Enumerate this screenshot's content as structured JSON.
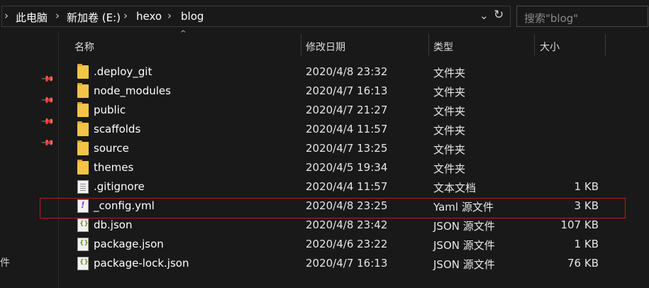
{
  "address_bar": {
    "crumbs": [
      "此电脑",
      "新加卷 (E:)",
      "hexo",
      "blog"
    ],
    "separator": "›",
    "chevron": "⌄",
    "refresh": "↻"
  },
  "search": {
    "placeholder": "搜索\"blog\""
  },
  "nav": {
    "pins": 4,
    "partial_label": "件"
  },
  "columns": {
    "name": "名称",
    "date": "修改日期",
    "type": "类型",
    "size": "大小"
  },
  "files": [
    {
      "name": ".deploy_git",
      "date": "2020/4/8 23:32",
      "type": "文件夹",
      "size": "",
      "icon": "folder-icon"
    },
    {
      "name": "node_modules",
      "date": "2020/4/7 16:13",
      "type": "文件夹",
      "size": "",
      "icon": "folder-icon"
    },
    {
      "name": "public",
      "date": "2020/4/7 21:27",
      "type": "文件夹",
      "size": "",
      "icon": "folder-icon"
    },
    {
      "name": "scaffolds",
      "date": "2020/4/4 11:57",
      "type": "文件夹",
      "size": "",
      "icon": "folder-icon"
    },
    {
      "name": "source",
      "date": "2020/4/7 13:25",
      "type": "文件夹",
      "size": "",
      "icon": "folder-icon"
    },
    {
      "name": "themes",
      "date": "2020/4/5 19:34",
      "type": "文件夹",
      "size": "",
      "icon": "folder-icon"
    },
    {
      "name": ".gitignore",
      "date": "2020/4/4 11:57",
      "type": "文本文档",
      "size": "1 KB",
      "icon": "text-file-icon"
    },
    {
      "name": "_config.yml",
      "date": "2020/4/8 23:25",
      "type": "Yaml 源文件",
      "size": "3 KB",
      "icon": "yaml-file-icon"
    },
    {
      "name": "db.json",
      "date": "2020/4/8 23:42",
      "type": "JSON 源文件",
      "size": "107 KB",
      "icon": "json-file-icon"
    },
    {
      "name": "package.json",
      "date": "2020/4/6 23:22",
      "type": "JSON 源文件",
      "size": "1 KB",
      "icon": "json-file-icon"
    },
    {
      "name": "package-lock.json",
      "date": "2020/4/7 16:13",
      "type": "JSON 源文件",
      "size": "76 KB",
      "icon": "json-file-icon"
    }
  ],
  "highlight_color": "#c4161c",
  "accent_folder_color": "#f3c447"
}
